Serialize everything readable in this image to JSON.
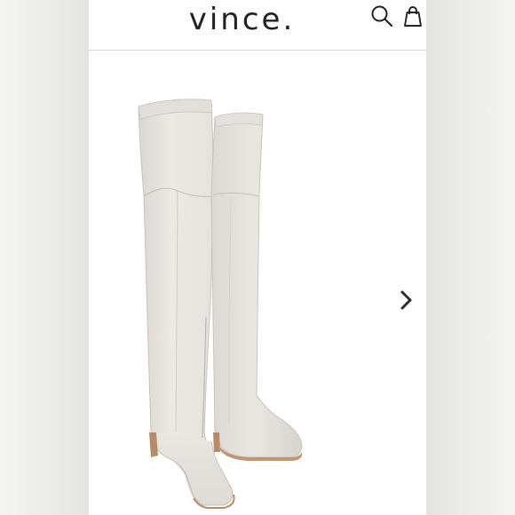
{
  "header": {
    "brand": "vince.",
    "search_icon": "search-icon",
    "bag_icon": "shopping-bag-icon"
  },
  "gallery": {
    "next_icon": "chevron-right-icon",
    "image_subject": "boot-pair"
  },
  "colors": {
    "boot_body": "#e7e4df",
    "boot_shadow": "#cfcbc5",
    "heel_wood": "#b88a66",
    "text_dark": "#222222",
    "backdrop": "#ececeb"
  }
}
